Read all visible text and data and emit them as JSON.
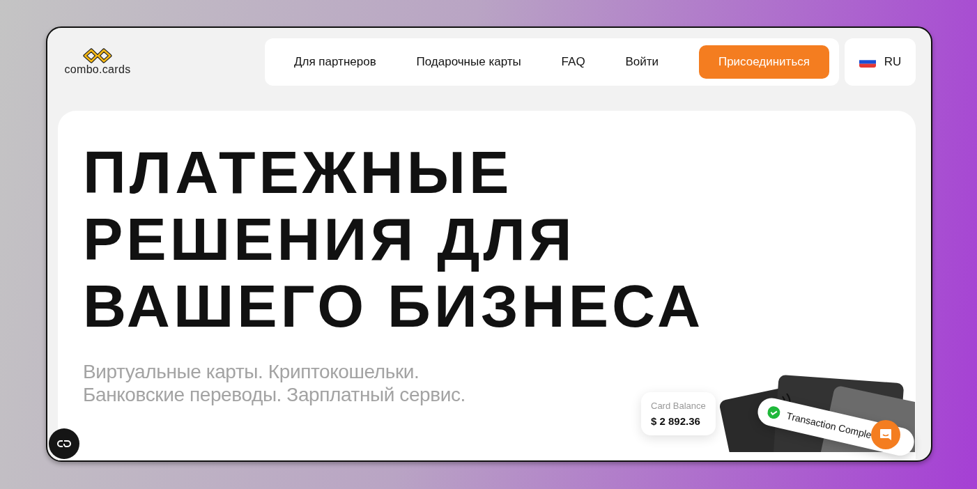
{
  "logo": {
    "text": "combo.cards"
  },
  "nav": [
    {
      "label": "Для партнеров",
      "kind": "link"
    },
    {
      "label": "Подарочные карты",
      "kind": "link"
    },
    {
      "label": "FAQ",
      "kind": "link"
    },
    {
      "label": "Войти",
      "kind": "link"
    },
    {
      "label": "Присоединиться",
      "kind": "cta"
    }
  ],
  "language": {
    "code": "RU"
  },
  "hero": {
    "heading": [
      "ПЛАТЕЖНЫЕ",
      "РЕШЕНИЯ ДЛЯ",
      "ВАШЕГО БИЗНЕСА"
    ],
    "subtitle": [
      "Виртуальные карты. Криптокошельки.",
      "Банковские переводы. Зарплатный сервис."
    ],
    "balance": {
      "label": "Card Balance",
      "amount": "$ 2 892.36"
    },
    "toast": {
      "text": "Transaction Comple"
    }
  }
}
